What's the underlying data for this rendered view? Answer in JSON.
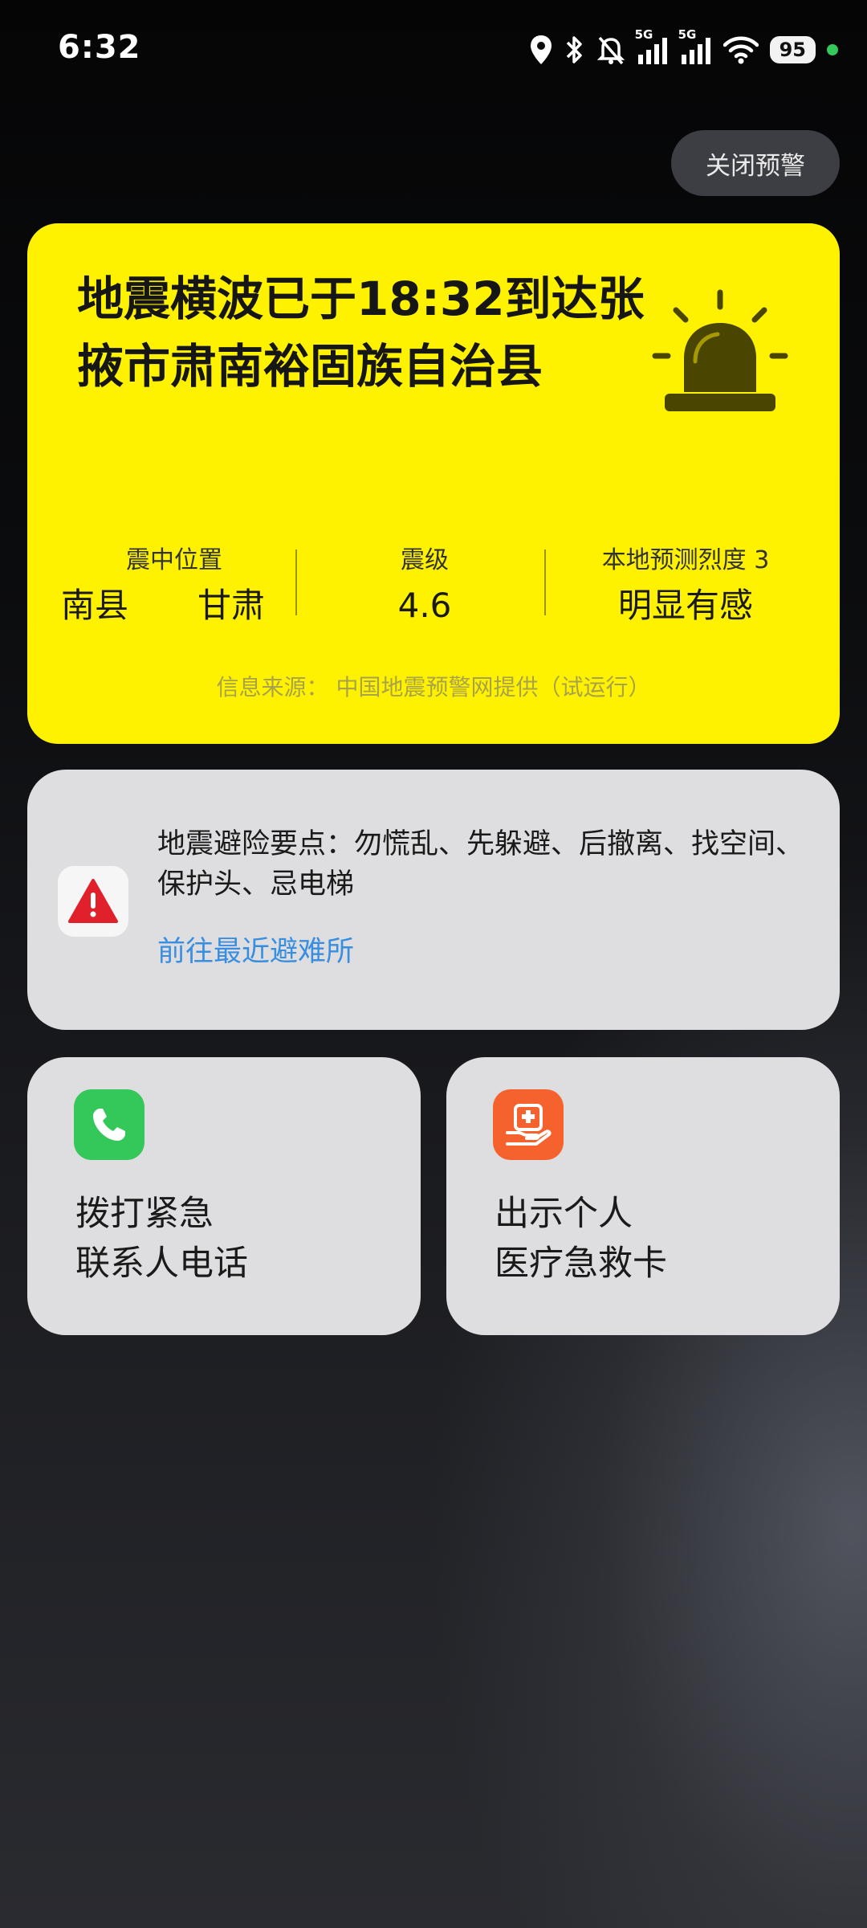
{
  "status_bar": {
    "time": "6:32",
    "network_1": "5G",
    "network_2": "5G",
    "battery": "95",
    "icons": [
      "location-icon",
      "bluetooth-icon",
      "silent-bell-icon",
      "signal-icon",
      "signal-icon",
      "wifi-icon"
    ]
  },
  "close_alert_label": "关闭预警",
  "alert": {
    "title": "地震横波已于18:32到达张掖市肃南裕固族自治县",
    "icon": "siren-icon",
    "background": "#fff200",
    "epicenter_label": "震中位置",
    "epicenter_value_1": "南县",
    "epicenter_value_2": "甘肃",
    "magnitude_label": "震级",
    "magnitude_value": "4.6",
    "intensity_label": "本地预测烈度 3",
    "intensity_value": "明显有感",
    "source": "信息来源： 中国地震预警网提供（试运行）"
  },
  "tips": {
    "icon": "warning-triangle-icon",
    "text": "地震避险要点：勿慌乱、先躲避、后撤离、找空间、保护头、忌电梯",
    "link": "前往最近避难所",
    "link_color": "#3a8ee0"
  },
  "actions": [
    {
      "icon": "phone-icon",
      "color": "#34c759",
      "line1": "拨打紧急",
      "line2": "联系人电话"
    },
    {
      "icon": "medical-card-icon",
      "color": "#f5622d",
      "line1": "出示个人",
      "line2": "医疗急救卡"
    }
  ]
}
